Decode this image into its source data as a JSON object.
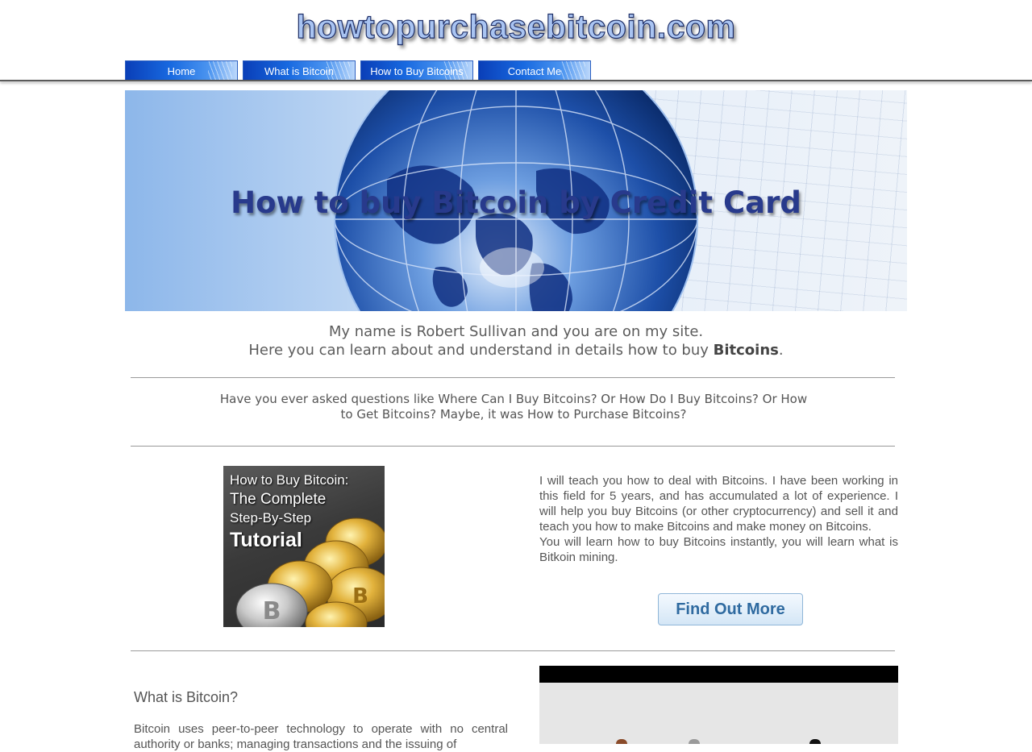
{
  "site": {
    "title": "howtopurchasebitcoin.com"
  },
  "nav": {
    "items": [
      {
        "label": "Home"
      },
      {
        "label": "What is Bitcoin"
      },
      {
        "label": "How to Buy Bitcoins"
      },
      {
        "label": "Contact Me"
      }
    ]
  },
  "banner": {
    "title": "How to buy Bitcoin by Credit Card"
  },
  "intro": {
    "line1": "My name is Robert Sullivan and you are on my site.",
    "line2_prefix": "Here you can learn about and understand in details how to buy ",
    "line2_bold": "Bitcoins",
    "line2_suffix": "."
  },
  "questions": {
    "text": "Have you ever asked questions like Where Can I Buy Bitcoins? Or How Do I Buy Bitcoins? Or How to Get Bitcoins? Maybe, it was How to Purchase Bitcoins?"
  },
  "book": {
    "line1": "How to Buy Bitcoin:",
    "line2": "The Complete",
    "line3": "Step-By-Step",
    "line4": "Tutorial"
  },
  "teach": {
    "para1": "I will teach you how to deal with Bitcoins. I have been working in this field for 5 years, and has accumulated a lot of experience. I will help you buy Bitcoins (or other cryptocurrency) and sell it and teach you how to make Bitcoins and make money on Bitcoins.",
    "para2": "You will learn how to buy Bitcoins instantly, you will learn what is Bitkoin mining.",
    "button": "Find Out More"
  },
  "what": {
    "title": "What is Bitcoin?",
    "body": "Bitcoin uses peer-to-peer technology to operate with no central authority or banks; managing transactions and the issuing of"
  }
}
